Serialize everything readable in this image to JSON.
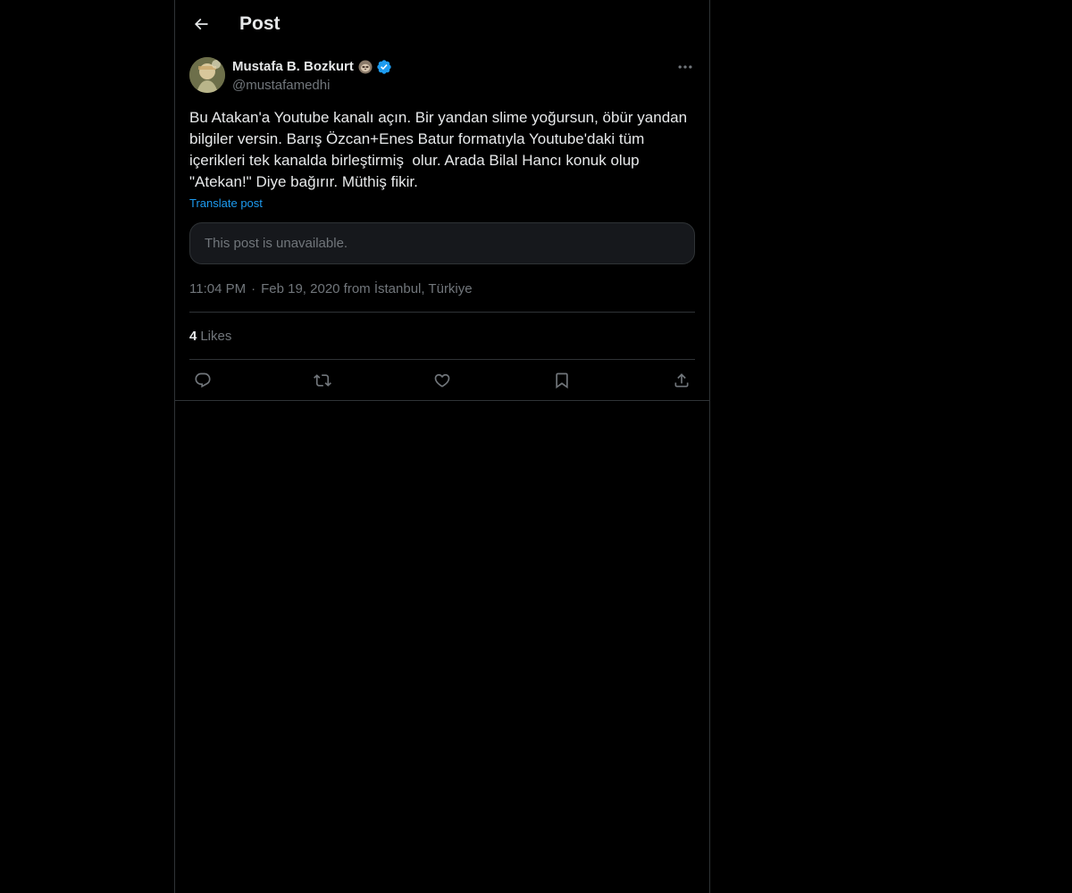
{
  "header": {
    "title": "Post",
    "back_icon": "arrow-left-icon"
  },
  "post": {
    "author": {
      "display_name": "Mustafa B. Bozkurt",
      "username": "@mustafamedhi",
      "emoji_badge": "sloth-emoji-icon",
      "verified": true,
      "verified_color": "#1d9bf0"
    },
    "text": "Bu Atakan'a Youtube kanalı açın. Bir yandan slime yoğursun, öbür yandan bilgiler versin. Barış Özcan+Enes Batur formatıyla Youtube'daki tüm içerikleri tek kanalda birleştirmiş  olur. Arada Bilal Hancı konuk olup \"Atekan!\" Diye bağırır. Müthiş fikir.",
    "translate_label": "Translate post",
    "quoted_post": "This post is unavailable.",
    "time": "11:04 PM",
    "date_location": "Feb 19, 2020 from İstanbul, Türkiye",
    "separator": "·",
    "likes_count": "4",
    "likes_label": "Likes",
    "actions": [
      "reply-icon",
      "repost-icon",
      "like-icon",
      "bookmark-icon",
      "share-icon"
    ]
  },
  "colors": {
    "background": "#000000",
    "text_primary": "#e7e9ea",
    "text_secondary": "#71767b",
    "accent": "#1d9bf0",
    "border": "#2f3336"
  }
}
